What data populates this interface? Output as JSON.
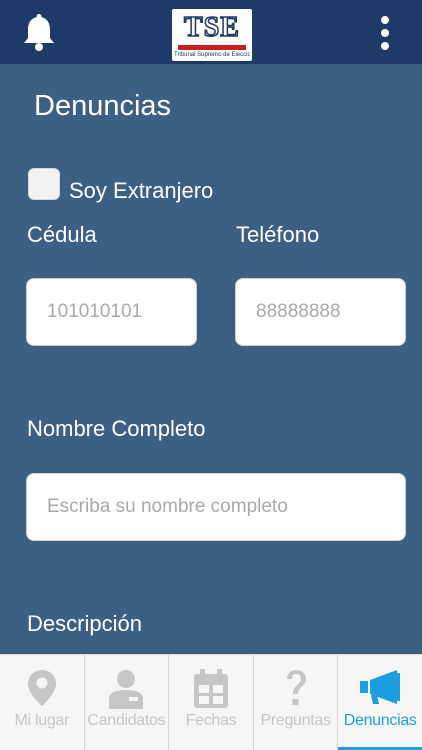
{
  "header": {
    "notification_icon": "bell-icon",
    "menu_icon": "more-vertical-icon",
    "logo": {
      "letters": "TSE",
      "caption": "Tribunal Supremo de Elecciones"
    }
  },
  "page": {
    "title": "Denuncias"
  },
  "form": {
    "foreigner_checkbox": {
      "label": "Soy Extranjero",
      "checked": false
    },
    "cedula": {
      "label": "Cédula",
      "placeholder": "101010101"
    },
    "telefono": {
      "label": "Teléfono",
      "placeholder": "88888888"
    },
    "nombre": {
      "label": "Nombre Completo",
      "placeholder": "Escriba su nombre completo"
    },
    "descripcion": {
      "label": "Descripción"
    }
  },
  "tabs": [
    {
      "label": "Mi lugar",
      "icon": "map-pin-icon",
      "active": false
    },
    {
      "label": "Candidatos",
      "icon": "person-icon",
      "active": false
    },
    {
      "label": "Fechas",
      "icon": "calendar-icon",
      "active": false
    },
    {
      "label": "Preguntas",
      "icon": "question-icon",
      "active": false
    },
    {
      "label": "Denuncias",
      "icon": "megaphone-icon",
      "active": true
    }
  ],
  "colors": {
    "header_bg": "#1e3a66",
    "content_bg": "#3c5f84",
    "accent": "#1d9ee0",
    "tab_inactive": "#c6c6c6"
  }
}
